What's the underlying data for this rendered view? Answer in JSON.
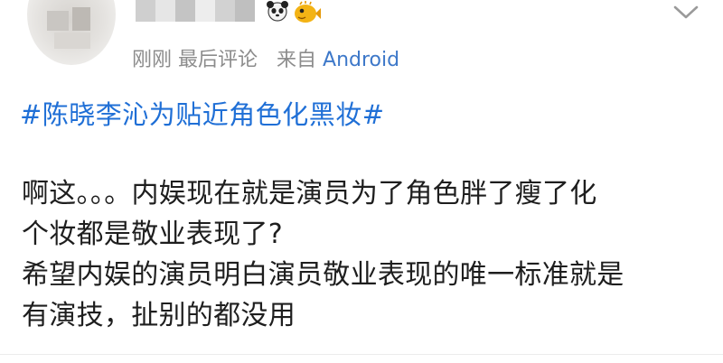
{
  "post": {
    "meta": {
      "time": "刚刚",
      "comment_state": "最后评论",
      "source_prefix": "来自",
      "source": "Android"
    },
    "topic": "#陈晓李沁为贴近角色化黑妆#",
    "body_lines": [
      "啊这。。。内娱现在就是演员为了角色胖了瘦了化",
      "个妆都是敬业表现了?",
      "希望内娱的演员明白演员敬业表现的唯一标准就是",
      "有演技，扯别的都没用"
    ]
  },
  "icons": {
    "avatar": "blurred-avatar",
    "badge_1": "panda-badge-icon",
    "badge_2": "pufferfish-badge-icon",
    "menu": "chevron-down-icon"
  },
  "colors": {
    "topic_link": "#1f6fd6",
    "source_link": "#3d78c9",
    "meta_gray": "#8c8c8c",
    "body_text": "#1e1e1e"
  }
}
